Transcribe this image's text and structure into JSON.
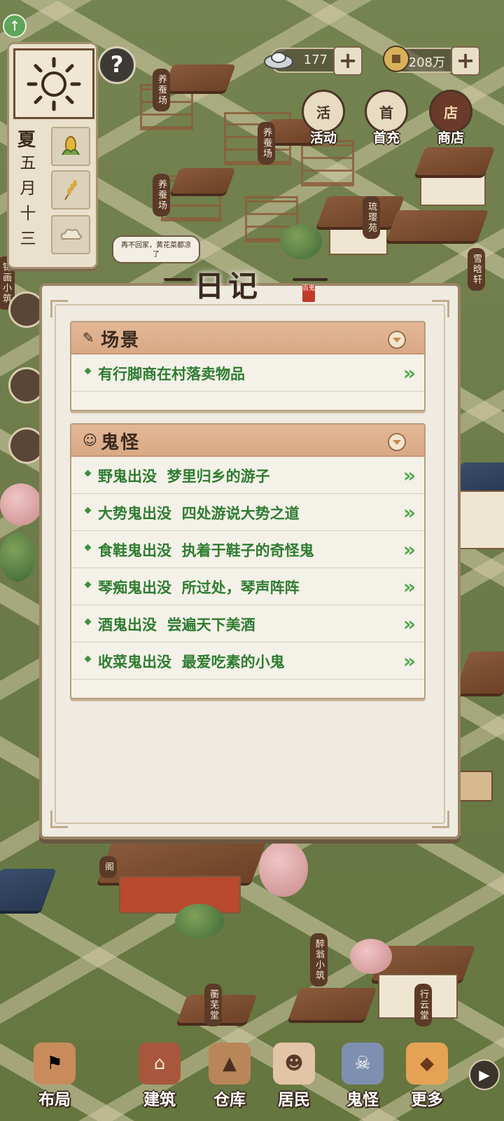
{
  "calendar": {
    "season": "夏",
    "date": [
      "五",
      "月",
      "十",
      "三"
    ]
  },
  "help_label": "?",
  "currency": [
    {
      "name": "silver-ingot",
      "value": "177",
      "plus": "+"
    },
    {
      "name": "copper-coin",
      "value": "208万",
      "plus": "+"
    }
  ],
  "top_buttons": [
    {
      "id": "activity",
      "icon_text": "活",
      "label": "活动"
    },
    {
      "id": "first-recharge",
      "icon_text": "首",
      "label": "首充"
    },
    {
      "id": "shop",
      "icon_text": "店",
      "label": "商店"
    }
  ],
  "map_labels": [
    "养蚕场",
    "养蚕场",
    "养蚕场",
    "琉璎苑",
    "雪晗轩",
    "阁",
    "醉翁小筑",
    "蘅芜堂",
    "行云堂",
    "锦画小筑"
  ],
  "npc_bubble": "再不回家，黄花菜都凉了",
  "diary": {
    "title": "日记",
    "seal": "百鬼",
    "sections": [
      {
        "id": "scene",
        "icon": "✎",
        "title": "场景",
        "items": [
          {
            "text": "有行脚商在村落卖物品"
          }
        ]
      },
      {
        "id": "ghost",
        "icon": "☺",
        "title": "鬼怪",
        "items": [
          {
            "text": "野鬼出没  梦里归乡的游子"
          },
          {
            "text": "大势鬼出没  四处游说大势之道"
          },
          {
            "text": "食鞋鬼出没  执着于鞋子的奇怪鬼"
          },
          {
            "text": "琴痴鬼出没  所过处，琴声阵阵"
          },
          {
            "text": "酒鬼出没  尝遍天下美酒"
          },
          {
            "text": "收菜鬼出没  最爱吃素的小鬼"
          }
        ]
      }
    ],
    "go_glyph": "»"
  },
  "bottom_nav": [
    {
      "id": "layout",
      "label": "布局",
      "icon": "⚑"
    },
    {
      "id": "build",
      "label": "建筑",
      "icon": "⌂"
    },
    {
      "id": "warehouse",
      "label": "仓库",
      "icon": "▲"
    },
    {
      "id": "residents",
      "label": "居民",
      "icon": "☻"
    },
    {
      "id": "ghosts",
      "label": "鬼怪",
      "icon": "☠"
    },
    {
      "id": "more",
      "label": "更多",
      "icon": "◆"
    }
  ],
  "expand_arrow": "▶",
  "up_arrow": "↑"
}
